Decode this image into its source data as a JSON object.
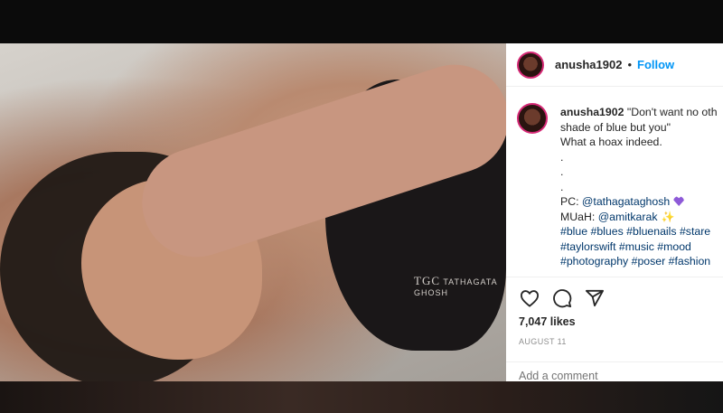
{
  "post": {
    "username": "anusha1902",
    "separator": "•",
    "follow_label": "Follow",
    "caption": {
      "username": "anusha1902",
      "line1": "\"Don't want no oth",
      "line2": "shade of blue but you\"",
      "line3": "What a hoax indeed.",
      "dot1": ".",
      "dot2": ".",
      "dot3": ".",
      "pc_label": "PC: ",
      "pc_handle": "@tathagataghosh",
      "muah_label": "MUaH: ",
      "muah_handle": "@amitkarak",
      "hashtags_line1": "#blue #blues #bluenails #stare",
      "hashtags_line2": "#taylorswift #music #mood",
      "hashtags_line3": "#photography #poser #fashion"
    },
    "likes": "7,047 likes",
    "date": "AUGUST 11",
    "comment_placeholder": "Add a comment"
  },
  "photo": {
    "watermark": "TATHAGATA GHOSH",
    "watermark_logo": "TGC"
  },
  "icons": {
    "like": "heart-icon",
    "comment": "comment-icon",
    "share": "share-icon"
  },
  "colors": {
    "follow": "#0095f6",
    "link": "#00376b",
    "avatar_ring": "#d62976"
  }
}
